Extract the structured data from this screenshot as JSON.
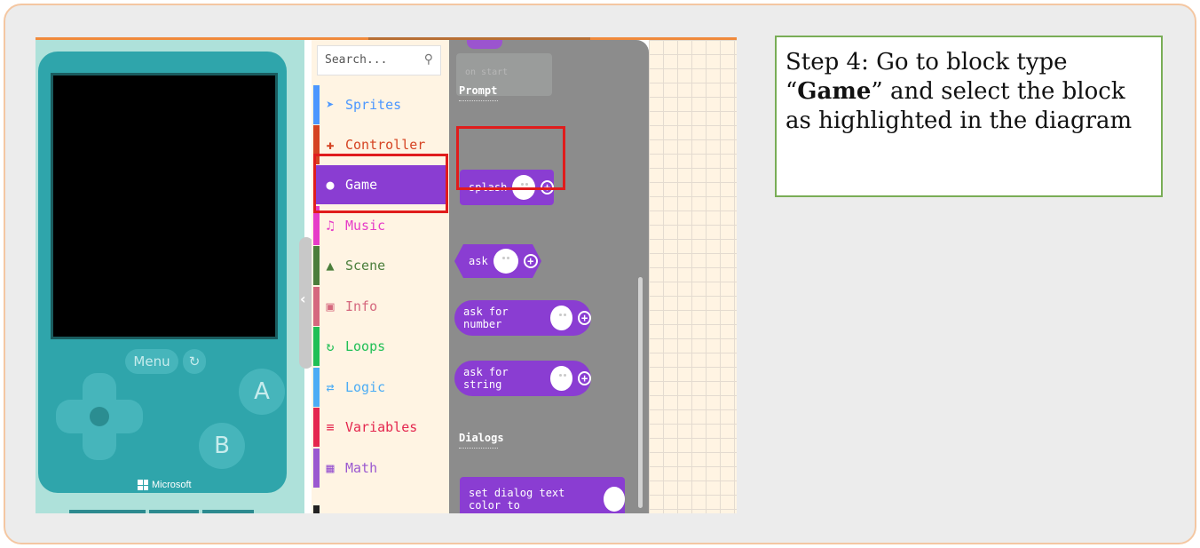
{
  "toolbox": {
    "search_placeholder": "Search...",
    "categories": [
      {
        "label": "Sprites",
        "icon": "paper-plane-icon",
        "color": "#4c97ff",
        "glyph": "➤"
      },
      {
        "label": "Controller",
        "icon": "gamepad-icon",
        "color": "#d54322",
        "glyph": "✚"
      },
      {
        "label": "Game",
        "icon": "circle-icon",
        "color": "#8a3dd2",
        "glyph": "●"
      },
      {
        "label": "Music",
        "icon": "headphones-icon",
        "color": "#e63cc8",
        "glyph": "♫"
      },
      {
        "label": "Scene",
        "icon": "tree-icon",
        "color": "#4b7e3b",
        "glyph": "▲"
      },
      {
        "label": "Info",
        "icon": "id-card-icon",
        "color": "#d5687e",
        "glyph": "▣"
      },
      {
        "label": "Loops",
        "icon": "refresh-icon",
        "color": "#20bf55",
        "glyph": "↻"
      },
      {
        "label": "Logic",
        "icon": "shuffle-icon",
        "color": "#4cacf5",
        "glyph": "⇄"
      },
      {
        "label": "Variables",
        "icon": "list-icon",
        "color": "#e4264e",
        "glyph": "≡"
      },
      {
        "label": "Math",
        "icon": "calculator-icon",
        "color": "#9b59d0",
        "glyph": "▦"
      }
    ],
    "selected": "Game"
  },
  "flyout": {
    "ghost_label": "on start",
    "section_prompt": "Prompt",
    "section_dialogs": "Dialogs",
    "blocks": {
      "splash": "splash",
      "ask": "ask",
      "ask_number": "ask for number",
      "ask_string": "ask for string",
      "dialog_color": "set dialog text color to"
    }
  },
  "simulator": {
    "menu_label": "Menu",
    "a_label": "A",
    "b_label": "B",
    "brand": "Microsoft"
  },
  "instruction": {
    "prefix": "Step 4: Go to block type “",
    "bold": "Game",
    "suffix": "” and select the block as highlighted in the diagram"
  },
  "colors": {
    "game_purple": "#8a3dd2",
    "console_teal": "#2fa5ab",
    "highlight_red": "#e01c1c",
    "note_border": "#79ad56"
  }
}
